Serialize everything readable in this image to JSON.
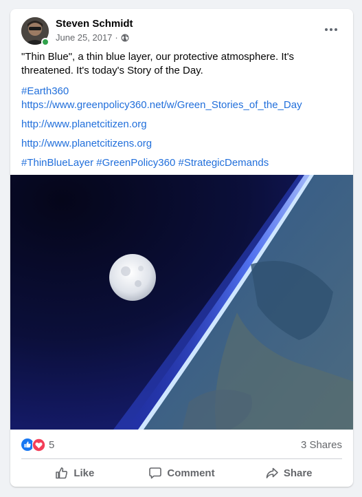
{
  "post": {
    "author": "Steven Schmidt",
    "date": "June 25, 2017",
    "separator": "·",
    "privacy_icon": "globe-icon",
    "text": {
      "line1": "\"Thin Blue\", a thin blue layer, our protective atmosphere. It's threatened. It's today's Story of the Day.",
      "hashtag_earth": "#Earth360",
      "link_greenpolicy": "https://www.greenpolicy360.net/w/Green_Stories_of_the_Day",
      "link_planetcitizen": "http://www.planetcitizen.org",
      "link_planetcitizens": "http://www.planetcitizens.org",
      "hashtags": "#ThinBlueLayer #GreenPolicy360 #StrategicDemands"
    }
  },
  "engagement": {
    "reaction_icons": [
      "like-icon",
      "love-icon"
    ],
    "reaction_count": "5",
    "shares": "3 Shares"
  },
  "actions": {
    "like": "Like",
    "comment": "Comment",
    "share": "Share"
  },
  "colors": {
    "link": "#216fdb",
    "like_blue": "#1877f2",
    "love_red": "#f33e58",
    "online_green": "#31a24c"
  }
}
